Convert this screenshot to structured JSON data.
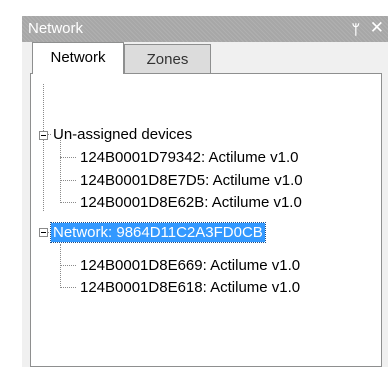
{
  "window": {
    "title": "Network",
    "pin_glyph": "ᛘ",
    "close_glyph": "✕"
  },
  "tabs": [
    {
      "label": "Network",
      "active": true
    },
    {
      "label": "Zones",
      "active": false
    }
  ],
  "tree": {
    "unassigned": {
      "label": "Un-assigned devices",
      "children": [
        "124B0001D79342: Actilume v1.0",
        "124B0001D8E7D5: Actilume v1.0",
        "124B0001D8E62B: Actilume v1.0"
      ]
    },
    "network": {
      "label": "Network: 9864D11C2A3FD0CB",
      "selected": true,
      "children": [
        "124B0001D8E669: Actilume v1.0",
        "124B0001D8E618: Actilume v1.0"
      ]
    }
  },
  "colors": {
    "titlebar": "#a7a7a7",
    "selection": "#3399ff"
  }
}
